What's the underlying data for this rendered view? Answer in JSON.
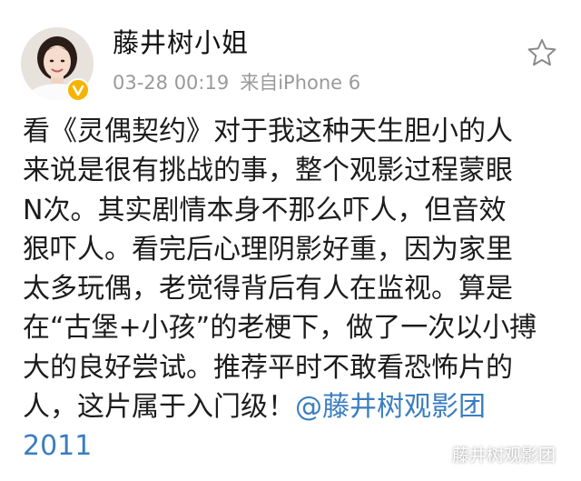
{
  "post": {
    "username": "藤井树小姐",
    "timestamp": "03-28 00:19",
    "source": "来自iPhone 6",
    "verified_badge_color": "#f6b400",
    "mention_color": "#3a7ec0",
    "content_lines": [
      "看《灵偶契约》对于我这种天生胆小的人",
      "来说是很有挑战的事，整个观影过程蒙眼",
      "N次。其实剧情本身不那么吓人，但音效",
      "狠吓人。看完后心理阴影好重，因为家里",
      "太多玩偶，老觉得背后有人在监视。算是",
      "在“古堡+小孩”的老梗下，做了一次以小搏",
      "大的良好尝试。推荐平时不敢看恐怖片的"
    ],
    "last_line_text": "人，这片属于入门级！",
    "mention_text": "@藤井树观影团",
    "mention_tail": "2011"
  },
  "icons": {
    "favorite": "star-outline-icon",
    "verified": "verified-badge-icon",
    "watermark": "wechat-icon"
  },
  "watermark": {
    "text": "藤井树观影团"
  }
}
